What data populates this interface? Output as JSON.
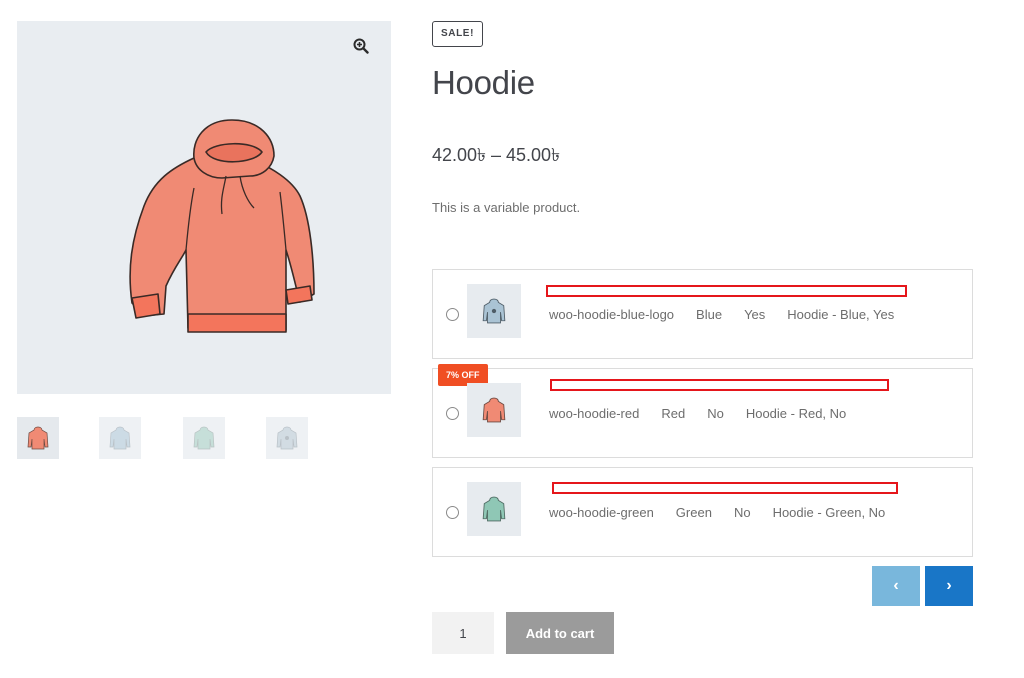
{
  "product": {
    "sale_badge": "SALE!",
    "title": "Hoodie",
    "price": "42.00৳ – 45.00৳",
    "description": "This is a variable product."
  },
  "gallery": {
    "zoom_icon": "zoom-in-icon",
    "main_color": "#f08a74",
    "thumbnails": [
      {
        "name": "hoodie-red",
        "color": "#f08a74"
      },
      {
        "name": "hoodie-blue",
        "color": "#b8cfdc"
      },
      {
        "name": "hoodie-green",
        "color": "#a9d3c5"
      },
      {
        "name": "hoodie-blue-logo",
        "color": "#c3d2dc"
      }
    ]
  },
  "variations": [
    {
      "sku": "woo-hoodie-blue-logo",
      "color": "Blue",
      "logo": "Yes",
      "name": "Hoodie - Blue, Yes",
      "badge": "",
      "thumb_color": "#aac3d4"
    },
    {
      "sku": "woo-hoodie-red",
      "color": "Red",
      "logo": "No",
      "name": "Hoodie - Red, No",
      "badge": "7% OFF",
      "thumb_color": "#f08a74"
    },
    {
      "sku": "woo-hoodie-green",
      "color": "Green",
      "logo": "No",
      "name": "Hoodie - Green, No",
      "badge": "",
      "thumb_color": "#8fc7b5"
    }
  ],
  "pagination": {
    "prev_label": "‹",
    "next_label": "›"
  },
  "cart": {
    "quantity": "1",
    "add_label": "Add to cart"
  },
  "colors": {
    "accent": "#1976c7",
    "accent_light": "#79b7dc",
    "badge": "#f04e23",
    "highlight": "#e5161b"
  }
}
